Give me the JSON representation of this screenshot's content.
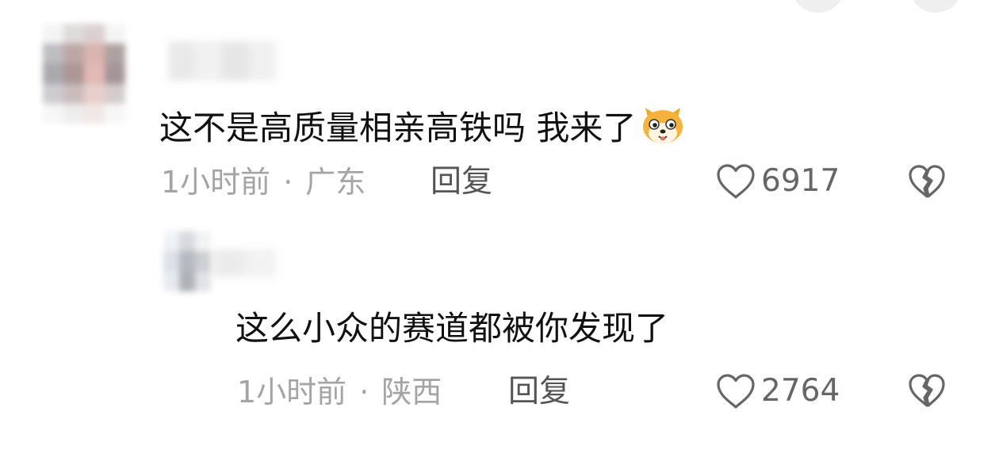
{
  "comments": [
    {
      "text": "这不是高质量相亲高铁吗 我来了",
      "emoji_icon": "shiba-dog-face-emoji",
      "time": "1小时前",
      "separator": "·",
      "location": "广东",
      "reply_label": "回复",
      "like_count": "6917"
    },
    {
      "text": "这么小众的赛道都被你发现了",
      "time": "1小时前",
      "separator": "·",
      "location": "陕西",
      "reply_label": "回复",
      "like_count": "2764"
    }
  ],
  "icons": {
    "like": "heart-outline-icon",
    "dislike": "broken-heart-icon"
  },
  "colors": {
    "text": "#111111",
    "meta": "#a4a4a4",
    "reply": "#555555",
    "icon": "#666666",
    "background": "#ffffff"
  }
}
